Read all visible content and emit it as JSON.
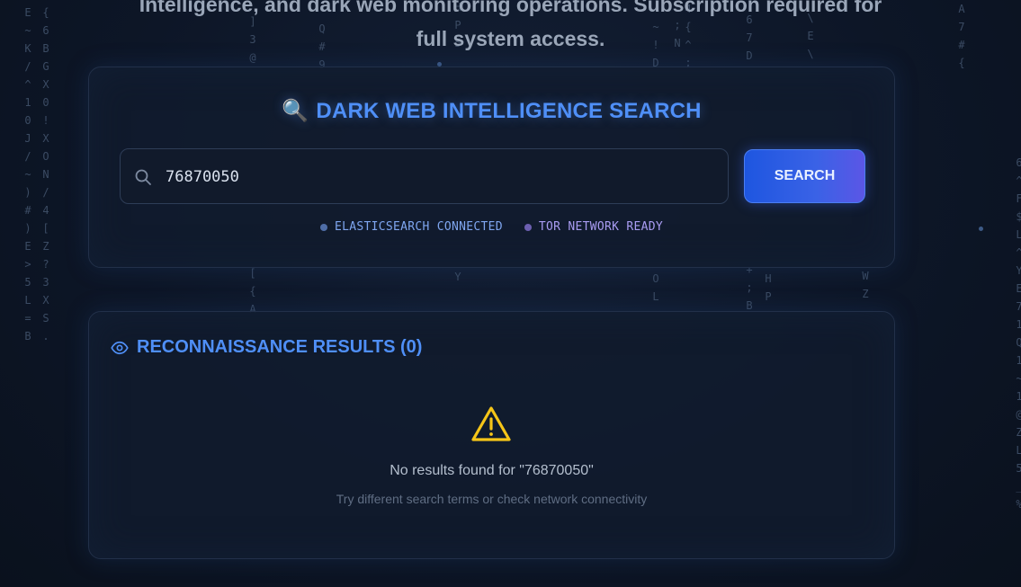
{
  "hero": {
    "line1": "Intelligence, and dark web monitoring operations. Subscription required for",
    "line2": "full system access."
  },
  "search_panel": {
    "emoji": "🔍",
    "title": "DARK WEB INTELLIGENCE SEARCH",
    "input_value": "76870050",
    "search_label": "SEARCH",
    "icon": "search-icon",
    "status": [
      {
        "label": "ELASTICSEARCH CONNECTED",
        "color": "#7fa6f0",
        "dot_color": "#4f6ea8"
      },
      {
        "label": "TOR NETWORK READY",
        "color": "#a99cf2",
        "dot_color": "#6c5fb0"
      }
    ]
  },
  "results_panel": {
    "icon": "eye-icon",
    "title": "RECONNAISSANCE RESULTS (0)",
    "empty_icon": "warning-icon",
    "empty_message": "No results found for \"76870050\"",
    "empty_hint": "Try different search terms or check network connectivity"
  },
  "background": {
    "columns": [
      "E~K/^10J/~)#)E>5L=B",
      "{6BGX0!XON/4[Z?3XS.",
      "]3@",
      "Q#9",
      "HP5",
      "~!D",
      ";N",
      "4{^;",
      "67D",
      "\\E\\",
      "A7#{",
      "[{A",
      "Y",
      "OL",
      "+;B",
      "HP",
      "WZ",
      "6^F$L^YE71Q1~1@ZL5_%"
    ]
  },
  "colors": {
    "accent": "#4f8ff7",
    "warning": "#f5c518",
    "button": "#3a62e6"
  }
}
